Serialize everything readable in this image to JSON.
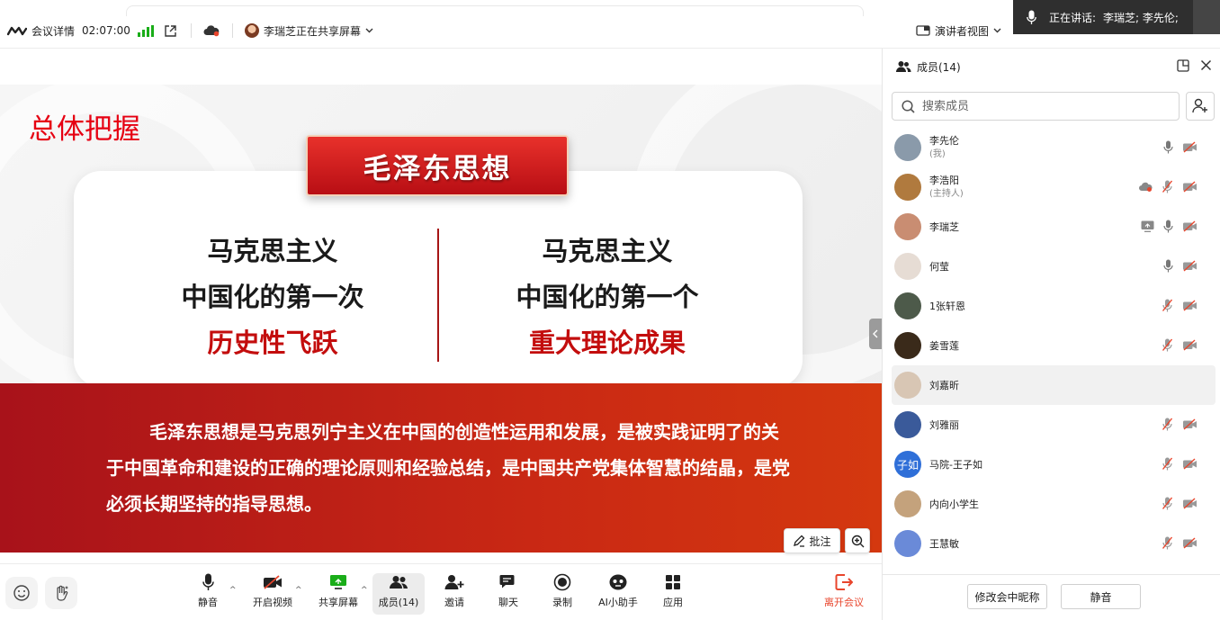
{
  "topbar": {
    "meeting_details": "会议详情",
    "elapsed": "02:07:00",
    "sharing_status": "李瑞芝正在共享屏幕",
    "view_mode": "演讲者视图"
  },
  "speaking_banner": {
    "label": "正在讲话:",
    "names": "李瑞芝; 李先伦;"
  },
  "slide": {
    "section_title": "总体把握",
    "ribbon_title": "毛泽东思想",
    "left_lines": [
      "马克思主义",
      "中国化的第一次",
      "历史性飞跃"
    ],
    "right_lines": [
      "马克思主义",
      "中国化的第一个",
      "重大理论成果"
    ],
    "summary": "毛泽东思想是马克思列宁主义在中国的创造性运用和发展，是被实践证明了的关于中国革命和建设的正确的理论原则和经验总结，是中国共产党集体智慧的结晶，是党必须长期坚持的指导思想。",
    "annotate_label": "批注"
  },
  "toolbar": {
    "mute": "静音",
    "start_video": "开启视频",
    "share_screen": "共享屏幕",
    "members": "成员(14)",
    "invite": "邀请",
    "chat": "聊天",
    "record": "录制",
    "ai_assistant": "AI小助手",
    "apps": "应用",
    "leave": "离开会议"
  },
  "panel": {
    "title": "成员(14)",
    "search_placeholder": "搜索成员",
    "members": [
      {
        "name": "李先伦",
        "role": "(我)",
        "avatar_color": "#8a9aaa",
        "mic": "on",
        "video": "off"
      },
      {
        "name": "李浩阳",
        "role": "(主持人)",
        "avatar_color": "#b07a3e",
        "mic": "off",
        "video": "off",
        "cloud": true
      },
      {
        "name": "李瑞芝",
        "role": "",
        "avatar_color": "#c98d72",
        "mic": "on",
        "video": "off",
        "screen": true
      },
      {
        "name": "何莹",
        "role": "",
        "avatar_color": "#e6dcd4",
        "mic": "on",
        "video": "off"
      },
      {
        "name": "1张轩恩",
        "role": "",
        "avatar_color": "#4d5a4a",
        "mic": "off",
        "video": "off"
      },
      {
        "name": "姜雪莲",
        "role": "",
        "avatar_color": "#3a2a1a",
        "mic": "off",
        "video": "off"
      },
      {
        "name": "刘嘉昕",
        "role": "",
        "avatar_color": "#d8c6b4",
        "mic": "none",
        "video": "none"
      },
      {
        "name": "刘雅丽",
        "role": "",
        "avatar_color": "#3a5a9a",
        "mic": "off",
        "video": "off"
      },
      {
        "name": "马院-王子如",
        "role": "",
        "avatar_color": "#2f6fd8",
        "avatar_text": "子如",
        "mic": "off",
        "video": "off"
      },
      {
        "name": "内向小学生",
        "role": "",
        "avatar_color": "#c4a27c",
        "mic": "off",
        "video": "off"
      },
      {
        "name": "王慧敏",
        "role": "",
        "avatar_color": "#6a8ad8",
        "mic": "off",
        "video": "off"
      }
    ],
    "rename_button": "修改会中昵称",
    "mute_button": "静音"
  }
}
